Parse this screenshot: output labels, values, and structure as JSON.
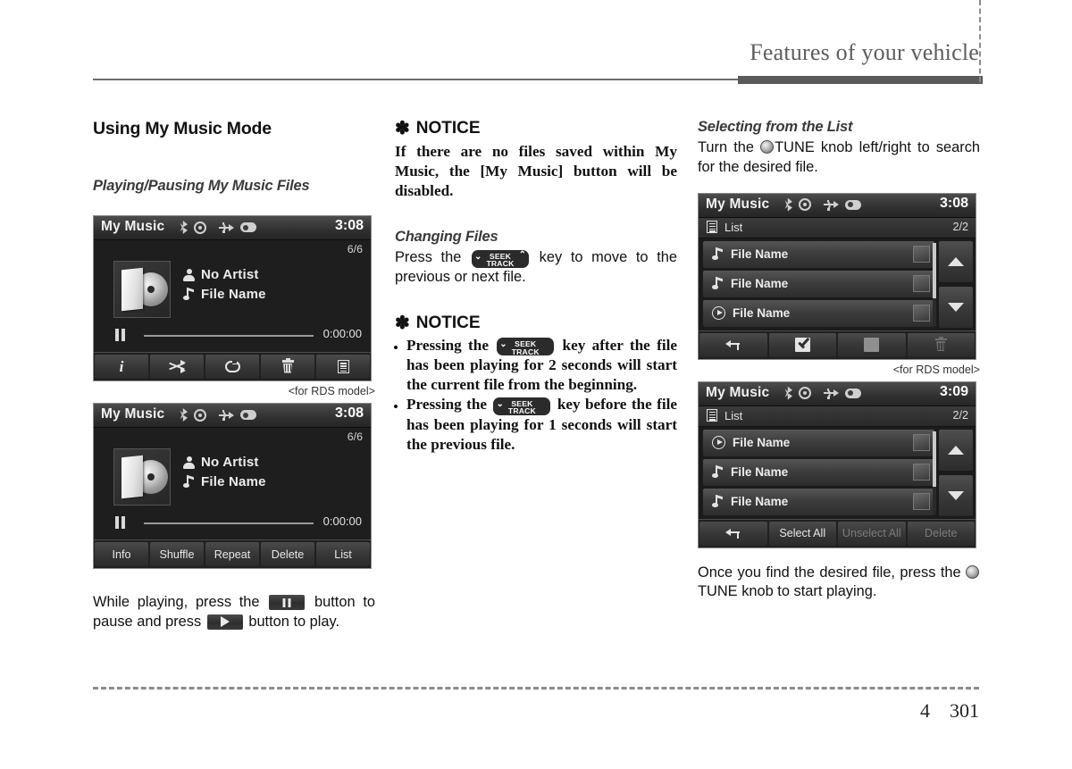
{
  "header": {
    "title": "Features of your vehicle"
  },
  "footer": {
    "chapter": "4",
    "page": "301"
  },
  "col1": {
    "section_title": "Using My Music Mode",
    "sub_title": "Playing/Pausing My Music Files",
    "caption": "<for RDS model>",
    "body_parts": {
      "p1": "While playing, press the",
      "p2": "button to pause and press",
      "p3": "button to play."
    },
    "screen_icon": {
      "title": "My Music",
      "clock": "3:08",
      "track_count": "6/6",
      "artist": "No Artist",
      "file": "File Name",
      "time": "0:00:00",
      "buttons": [
        {
          "name": "info-button",
          "icon": "info-icon",
          "label": ""
        },
        {
          "name": "shuffle-button",
          "icon": "shuffle-icon",
          "label": ""
        },
        {
          "name": "repeat-button",
          "icon": "repeat-icon",
          "label": ""
        },
        {
          "name": "delete-button",
          "icon": "trash-icon",
          "label": ""
        },
        {
          "name": "list-button",
          "icon": "list-icon",
          "label": ""
        }
      ]
    },
    "screen_text": {
      "title": "My Music",
      "clock": "3:08",
      "track_count": "6/6",
      "artist": "No Artist",
      "file": "File Name",
      "time": "0:00:00",
      "buttons": [
        {
          "name": "info-button",
          "label": "Info"
        },
        {
          "name": "shuffle-button",
          "label": "Shuffle"
        },
        {
          "name": "repeat-button",
          "label": "Repeat"
        },
        {
          "name": "delete-button",
          "label": "Delete"
        },
        {
          "name": "list-button",
          "label": "List"
        }
      ]
    }
  },
  "col2": {
    "notice1": {
      "star": "✽",
      "title": "NOTICE",
      "body": "If there are no files saved within My Music, the [My Music] button will be disabled."
    },
    "changing": {
      "title": "Changing Files",
      "text_before": "Press the",
      "text_after": "key to move to the previous or next file."
    },
    "notice2": {
      "star": "✽",
      "title": "NOTICE",
      "item1_before": "Pressing the",
      "item1_after": "key after the file has been playing for 2 seconds will start the current file from the beginning.",
      "item2_before": "Pressing the",
      "item2_after": "key before the file has been playing for 1 seconds will start the previous file."
    },
    "seek_key": {
      "top": "SEEK",
      "bottom": "TRACK",
      "left_chevron": "⌄",
      "right_chevron": "⌃"
    }
  },
  "col3": {
    "sub_title": "Selecting from the List",
    "intro_before": "Turn the",
    "intro_knob": "TUNE",
    "intro_after": "knob left/right to search for the desired file.",
    "caption": "<for RDS model>",
    "outro_before": "Once you find the desired file, press the",
    "outro_knob": "TUNE",
    "outro_after": "knob to start playing.",
    "list_screen_1": {
      "title": "My Music",
      "clock": "3:08",
      "list_label": "List",
      "page": "2/2",
      "rows": [
        {
          "icon": "music-note-icon",
          "label": "File Name"
        },
        {
          "icon": "music-note-icon",
          "label": "File Name"
        },
        {
          "icon": "play-circle-icon",
          "label": "File Name"
        }
      ],
      "buttons": [
        {
          "name": "back-button",
          "icon": "back-arrow-icon",
          "label": ""
        },
        {
          "name": "select-all-button",
          "icon": "checkbox-checked-icon",
          "label": ""
        },
        {
          "name": "unselect-all-button",
          "icon": "checkbox-empty-icon",
          "label": ""
        },
        {
          "name": "delete-button",
          "icon": "trash-icon",
          "label": ""
        }
      ]
    },
    "list_screen_2": {
      "title": "My Music",
      "clock": "3:09",
      "list_label": "List",
      "page": "2/2",
      "rows": [
        {
          "icon": "play-circle-icon",
          "label": "File Name"
        },
        {
          "icon": "music-note-icon",
          "label": "File Name"
        },
        {
          "icon": "music-note-icon",
          "label": "File Name"
        }
      ],
      "buttons": [
        {
          "name": "back-button",
          "label": ""
        },
        {
          "name": "select-all-button",
          "label": "Select All"
        },
        {
          "name": "unselect-all-button",
          "label": "Unselect All"
        },
        {
          "name": "delete-button",
          "label": "Delete"
        }
      ]
    }
  },
  "colors": {
    "page_bg": "#ffffff",
    "header_text": "#5d5d5d",
    "rule": "#5a5a5a",
    "screen_bg": "#1a1a1a",
    "screen_text": "#e8e8e8"
  }
}
